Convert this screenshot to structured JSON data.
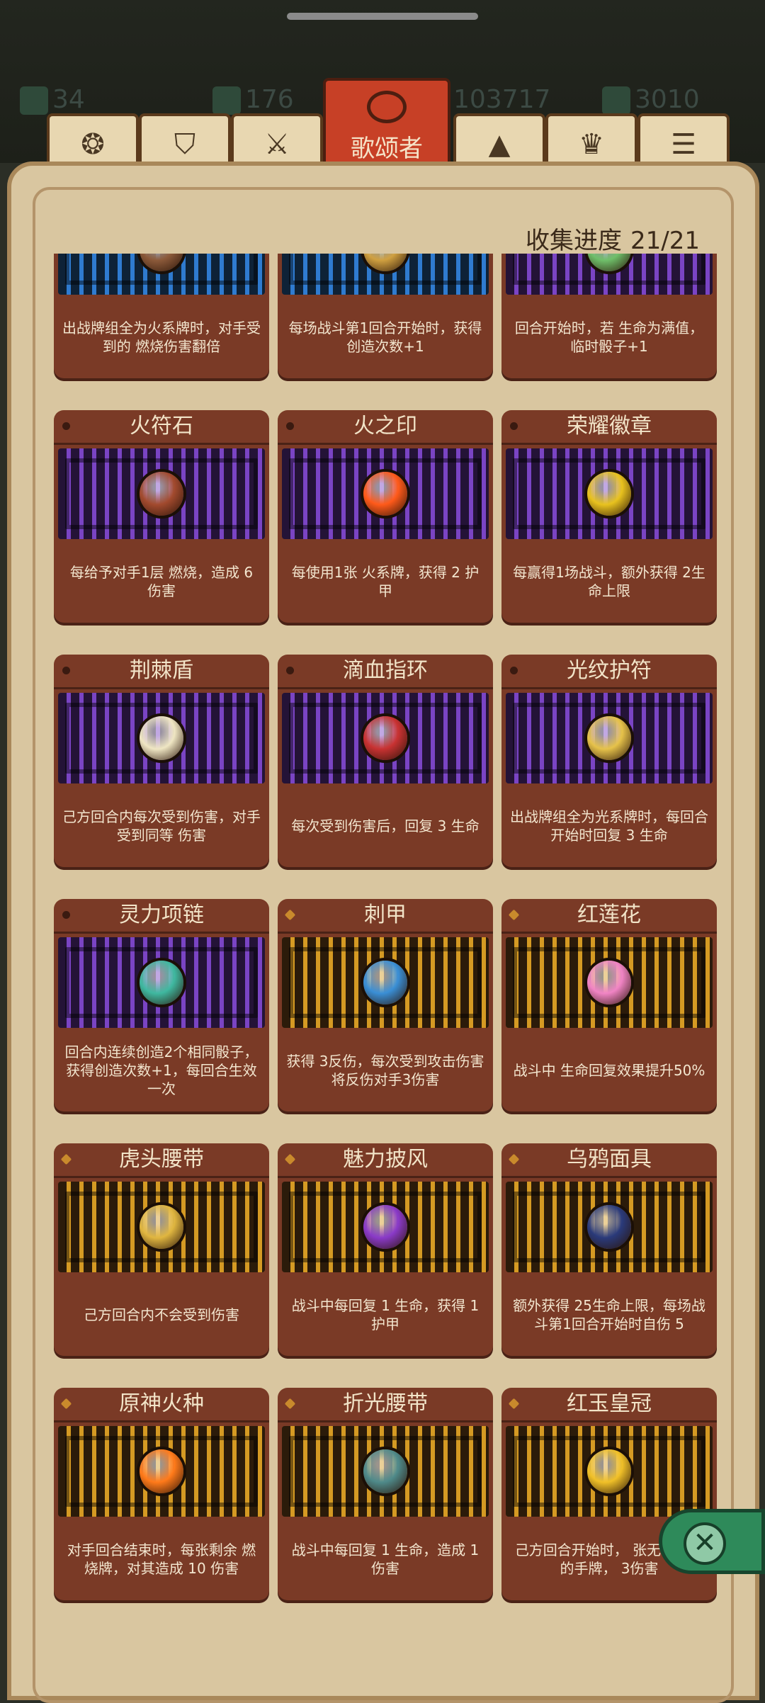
{
  "header": {
    "stats": [
      "34",
      "176",
      "103717",
      "3010"
    ],
    "tabs": [
      "",
      "",
      "",
      "歌颂者",
      "",
      "",
      ""
    ],
    "active_tab": "歌颂者",
    "tab_icons": [
      "coins-icon",
      "shield-icon",
      "slash-icon",
      "singer-icon",
      "triangle-icon",
      "crest-icon",
      "stack-icon"
    ]
  },
  "collection": {
    "label": "收集进度",
    "value": "21/21"
  },
  "relics": [
    {
      "name": "",
      "desc": "出战牌组全为火系牌时，对手受到的 燃烧伤害翻倍",
      "maze": "blue",
      "color": "#8c5a3a"
    },
    {
      "name": "",
      "desc": "每场战斗第1回合开始时，获得创造次数+1",
      "maze": "blue",
      "color": "#d0a040"
    },
    {
      "name": "",
      "desc": "回合开始时，若 生命为满值，临时骰子+1",
      "maze": "purple",
      "color": "#6fbf6a"
    },
    {
      "name": "火符石",
      "desc": "每给予对手1层 燃烧，造成 6 伤害",
      "maze": "purple",
      "color": "#a24a2e"
    },
    {
      "name": "火之印",
      "desc": "每使用1张 火系牌，获得 2 护甲",
      "maze": "purple",
      "color": "#ff5a1a"
    },
    {
      "name": "荣耀徽章",
      "desc": "每赢得1场战斗，额外获得 2生命上限",
      "maze": "purple",
      "color": "#e8c21e"
    },
    {
      "name": "荆棘盾",
      "desc": "己方回合内每次受到伤害，对手受到同等 伤害",
      "maze": "purple",
      "color": "#efe6c3"
    },
    {
      "name": "滴血指环",
      "desc": "每次受到伤害后，回复 3 生命",
      "maze": "purple",
      "color": "#c83232"
    },
    {
      "name": "光纹护符",
      "desc": "出战牌组全为光系牌时，每回合开始时回复 3 生命",
      "maze": "purple",
      "color": "#e6c24a"
    },
    {
      "name": "灵力项链",
      "desc": "回合内连续创造2个相同骰子，获得创造次数+1，每回合生效一次",
      "maze": "purple",
      "color": "#3fb8a0"
    },
    {
      "name": "刺甲",
      "desc": "获得 3反伤，每次受到攻击伤害将反伤对手3伤害",
      "maze": "gold",
      "color": "#3a8fd6"
    },
    {
      "name": "红莲花",
      "desc": "战斗中 生命回复效果提升50%",
      "maze": "gold",
      "color": "#f084c4"
    },
    {
      "name": "虎头腰带",
      "desc": "己方回合内不会受到伤害",
      "maze": "gold",
      "color": "#e0b640"
    },
    {
      "name": "魅力披风",
      "desc": "战斗中每回复 1 生命，获得 1 护甲",
      "maze": "gold",
      "color": "#8a3ac8"
    },
    {
      "name": "乌鸦面具",
      "desc": "额外获得 25生命上限，每场战斗第1回合开始时自伤 5",
      "maze": "gold",
      "color": "#2a3a7a"
    },
    {
      "name": "原神火种",
      "desc": "对手回合结束时，每张剩余 燃烧牌，对其造成 10 伤害",
      "maze": "gold",
      "color": "#ff7a1a"
    },
    {
      "name": "折光腰带",
      "desc": "战斗中每回复 1 生命，造成 1 伤害",
      "maze": "gold",
      "color": "#4f8a8a"
    },
    {
      "name": "红玉皇冠",
      "desc": "己方回合开始时， 张无法使用的手牌， 3伤害",
      "maze": "gold",
      "color": "#f0c028"
    }
  ],
  "close_label": "✕"
}
